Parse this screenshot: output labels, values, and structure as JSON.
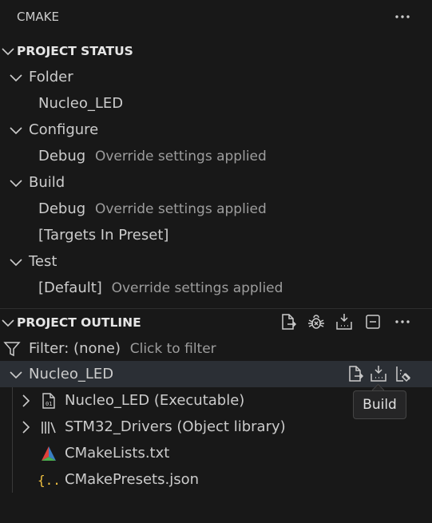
{
  "panel": {
    "title": "CMAKE",
    "more_icon": "ellipsis-icon"
  },
  "project_status": {
    "header": "PROJECT STATUS",
    "folder": {
      "label": "Folder",
      "value": "Nucleo_LED"
    },
    "configure": {
      "label": "Configure",
      "value": "Debug",
      "note": "Override settings applied"
    },
    "build": {
      "label": "Build",
      "value": "Debug",
      "note": "Override settings applied",
      "targets": "[Targets In Preset]"
    },
    "test": {
      "label": "Test",
      "value": "[Default]",
      "note": "Override settings applied"
    }
  },
  "project_outline": {
    "header": "PROJECT OUTLINE",
    "filter_label": "Filter: (none)",
    "filter_hint": "Click to filter",
    "root": {
      "label": "Nucleo_LED"
    },
    "items": [
      {
        "label": "Nucleo_LED (Executable)",
        "icon": "executable-icon"
      },
      {
        "label": "STM32_Drivers (Object library)",
        "icon": "library-icon"
      },
      {
        "label": "CMakeLists.txt",
        "icon": "cmake-file-icon"
      },
      {
        "label": "CMakePresets.json",
        "icon": "json-file-icon"
      }
    ]
  },
  "tooltip": {
    "text": "Build"
  },
  "colors": {
    "background": "#181818",
    "selection": "#2b2f35",
    "json_icon": "#f0c040",
    "text": "#cccccc",
    "muted": "#9d9d9d"
  }
}
